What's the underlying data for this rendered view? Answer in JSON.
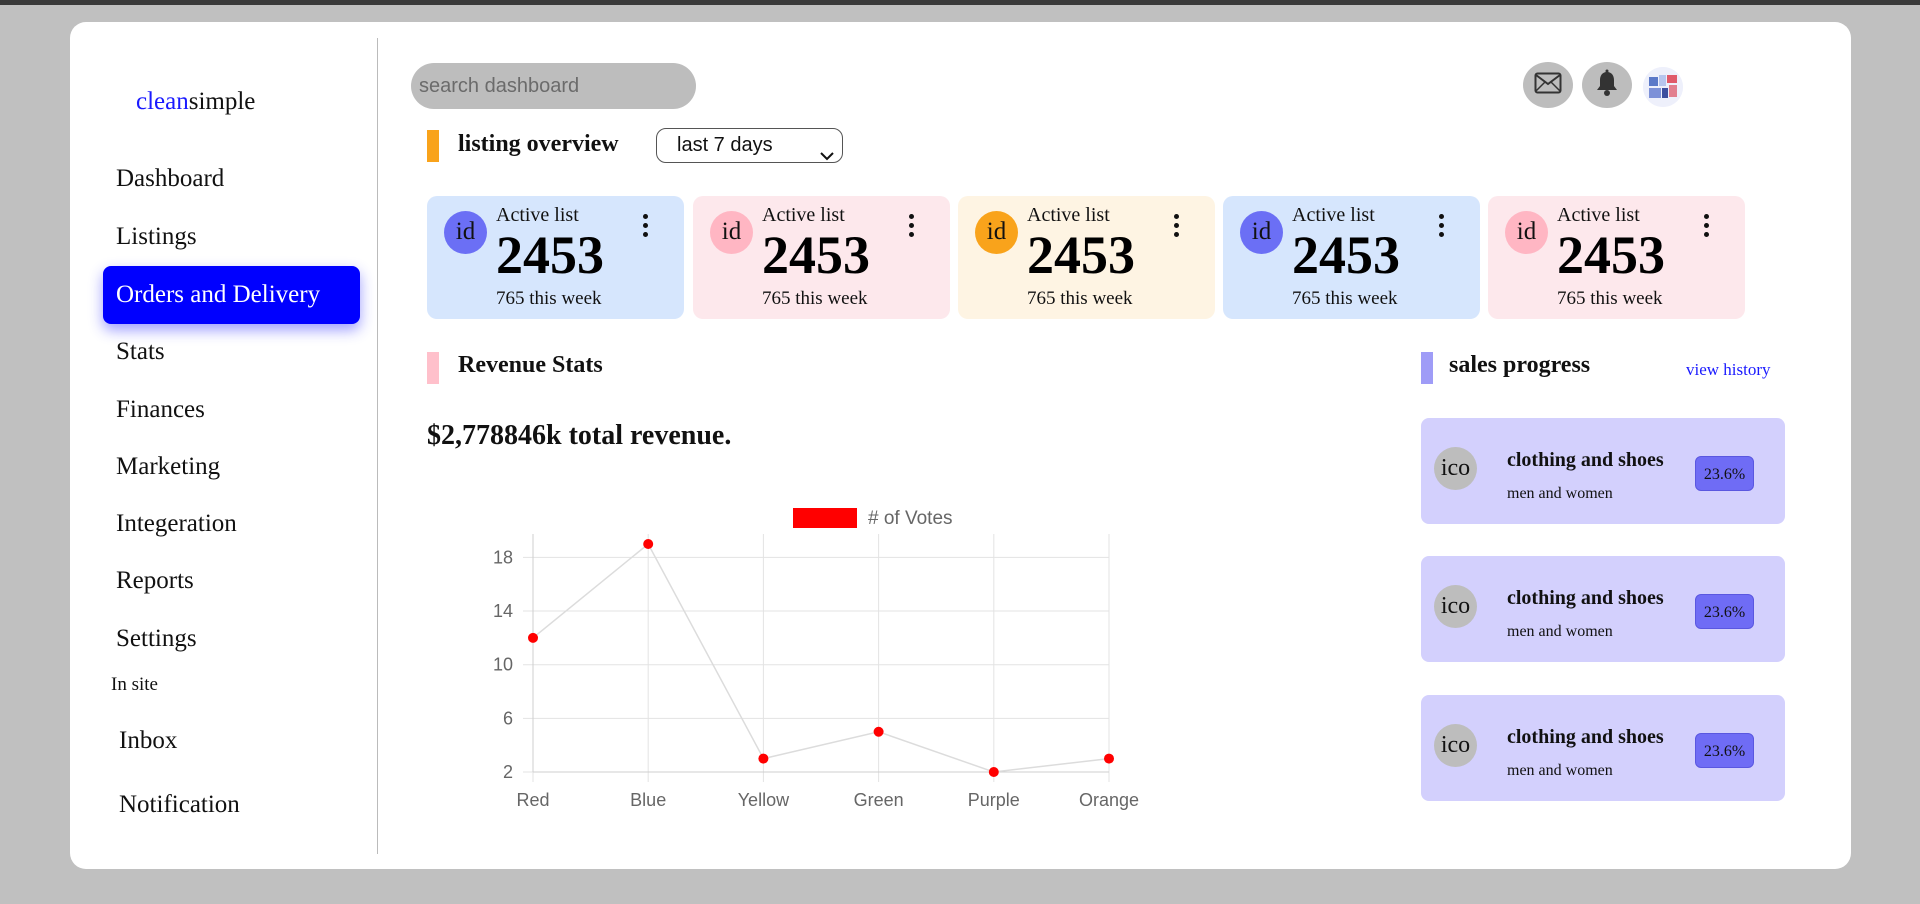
{
  "brand": {
    "part1": "clean",
    "part2": "simple"
  },
  "sidebar": {
    "items": [
      {
        "label": "Dashboard"
      },
      {
        "label": "Listings"
      },
      {
        "label": "Orders and Delivery"
      },
      {
        "label": "Stats"
      },
      {
        "label": "Finances"
      },
      {
        "label": "Marketing"
      },
      {
        "label": "Integeration"
      },
      {
        "label": "Reports"
      },
      {
        "label": "Settings"
      }
    ],
    "section_label": "In site",
    "site_items": [
      {
        "label": "Inbox"
      },
      {
        "label": "Notification"
      }
    ]
  },
  "header": {
    "search_placeholder": "search dashboard",
    "icons": [
      "mail-icon",
      "bell-icon",
      "avatar-image"
    ]
  },
  "overview": {
    "title": "listing overview",
    "period": "last 7 days",
    "cards": [
      {
        "icon_text": "id",
        "label": "Active list",
        "value": "2453",
        "sub": "765 this week",
        "bg": "#d6e6fd",
        "icon_bg": "#6b6ff5"
      },
      {
        "icon_text": "id",
        "label": "Active list",
        "value": "2453",
        "sub": "765 this week",
        "bg": "#fde8ec",
        "icon_bg": "#ffb6c3"
      },
      {
        "icon_text": "id",
        "label": "Active list",
        "value": "2453",
        "sub": "765 this week",
        "bg": "#fef4e3",
        "icon_bg": "#f9a31b"
      },
      {
        "icon_text": "id",
        "label": "Active list",
        "value": "2453",
        "sub": "765 this week",
        "bg": "#d6e6fd",
        "icon_bg": "#6b6ff5"
      },
      {
        "icon_text": "id",
        "label": "Active list",
        "value": "2453",
        "sub": "765 this week",
        "bg": "#fde8ec",
        "icon_bg": "#ffb6c3"
      }
    ]
  },
  "revenue": {
    "title": "Revenue Stats",
    "total_text": "$2,778846k total revenue."
  },
  "chart_data": {
    "type": "line",
    "categories": [
      "Red",
      "Blue",
      "Yellow",
      "Green",
      "Purple",
      "Orange"
    ],
    "series": [
      {
        "name": "# of Votes",
        "values": [
          12,
          19,
          3,
          5,
          2,
          3
        ],
        "color": "#ff0000"
      }
    ],
    "yticks": [
      2,
      6,
      10,
      14,
      18
    ],
    "ylim": [
      2,
      19
    ],
    "grid": true,
    "legend": "top"
  },
  "sales": {
    "title": "sales progress",
    "link": "view history",
    "items": [
      {
        "icon_text": "ico",
        "title": "clothing and shoes",
        "subtitle": "men and women",
        "percent": "23.6%"
      },
      {
        "icon_text": "ico",
        "title": "clothing and shoes",
        "subtitle": "men and women",
        "percent": "23.6%"
      },
      {
        "icon_text": "ico",
        "title": "clothing and shoes",
        "subtitle": "men and women",
        "percent": "23.6%"
      }
    ]
  },
  "colors": {
    "accent_blue": "#0000ff",
    "overview_bar": "#f9a31b",
    "revenue_bar": "#ffc0cb",
    "sales_bar": "#9f9cf7"
  }
}
